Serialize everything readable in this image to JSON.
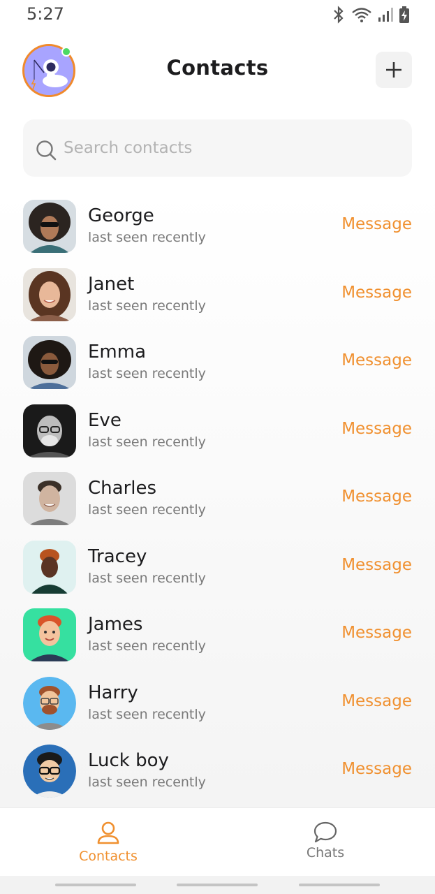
{
  "status_bar": {
    "time": "5:27"
  },
  "header": {
    "title": "Contacts",
    "add_label": "+"
  },
  "search": {
    "placeholder": "Search contacts",
    "value": ""
  },
  "contacts": [
    {
      "name": "George",
      "status": "last seen recently",
      "action": "Message"
    },
    {
      "name": "Janet",
      "status": "last seen recently",
      "action": "Message"
    },
    {
      "name": "Emma",
      "status": "last seen recently",
      "action": "Message"
    },
    {
      "name": "Eve",
      "status": "last seen recently",
      "action": "Message"
    },
    {
      "name": "Charles",
      "status": "last seen recently",
      "action": "Message"
    },
    {
      "name": "Tracey",
      "status": "last seen recently",
      "action": "Message"
    },
    {
      "name": "James",
      "status": "last seen recently",
      "action": "Message"
    },
    {
      "name": "Harry",
      "status": "last seen recently",
      "action": "Message"
    },
    {
      "name": "Luck boy",
      "status": "last seen recently",
      "action": "Message"
    }
  ],
  "bottom_nav": {
    "contacts_label": "Contacts",
    "chats_label": "Chats",
    "active": "contacts"
  },
  "colors": {
    "accent": "#f0902f",
    "online": "#4cd964",
    "avatar_bg": "#a8a4ff"
  },
  "icons": {
    "status": [
      "bluetooth-icon",
      "wifi-icon",
      "signal-icon",
      "battery-charging-icon"
    ],
    "header": [
      "plus-icon"
    ],
    "search": "search-icon",
    "nav": [
      "person-icon",
      "chat-bubble-icon"
    ]
  }
}
